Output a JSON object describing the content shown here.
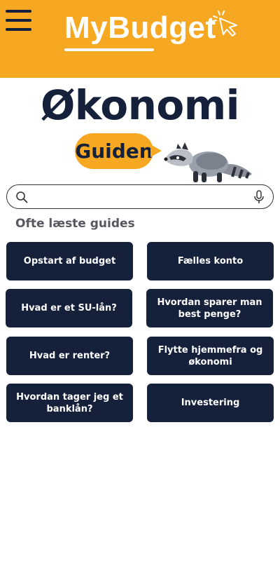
{
  "header": {
    "menu_icon": "hamburger-menu-icon",
    "logo_text": "MyBudget",
    "logo_icon": "cursor-click-icon",
    "background_color": "#F7A823"
  },
  "hero": {
    "title": "Økonomi",
    "badge_text": "Guiden",
    "mascot": "raccoon-illustration"
  },
  "search": {
    "placeholder": "",
    "value": "",
    "left_icon": "search-icon",
    "right_icon": "microphone-icon"
  },
  "section": {
    "title": "Ofte læste guides"
  },
  "guides": [
    "Opstart af budget",
    "Fælles konto",
    "Hvad er et SU-lån?",
    "Hvordan sparer man best penge?",
    "Hvad er renter?",
    "Flytte hjemmefra og økonomi",
    "Hvordan tager jeg et banklån?",
    "Investering"
  ],
  "colors": {
    "accent": "#F7A823",
    "navy": "#15203a"
  }
}
